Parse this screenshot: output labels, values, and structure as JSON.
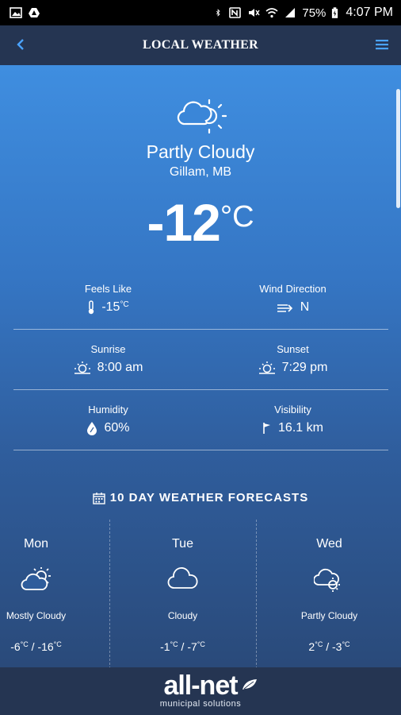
{
  "status_bar": {
    "battery": "75%",
    "time": "4:07 PM"
  },
  "app_bar": {
    "title": "LOCAL WEATHER"
  },
  "current": {
    "condition": "Partly Cloudy",
    "location": "Gillam, MB",
    "temperature": "-12",
    "unit": "°C"
  },
  "metrics": {
    "feels_like": {
      "label": "Feels Like",
      "value": "-15",
      "unit": "°C"
    },
    "wind_direction": {
      "label": "Wind Direction",
      "value": "N"
    },
    "sunrise": {
      "label": "Sunrise",
      "value": "8:00 am"
    },
    "sunset": {
      "label": "Sunset",
      "value": "7:29 pm"
    },
    "humidity": {
      "label": "Humidity",
      "value": "60%"
    },
    "visibility": {
      "label": "Visibility",
      "value": "16.1 km"
    }
  },
  "forecast": {
    "title": "10 DAY WEATHER FORECASTS",
    "days": [
      {
        "day": "Mon",
        "condition": "Mostly Cloudy",
        "high": "-6",
        "low": "-16",
        "unit": "°C",
        "icon": "sun-cloud-icon"
      },
      {
        "day": "Tue",
        "condition": "Cloudy",
        "high": "-1",
        "low": "-7",
        "unit": "°C",
        "icon": "cloud-icon"
      },
      {
        "day": "Wed",
        "condition": "Partly Cloudy",
        "high": "2",
        "low": "-3",
        "unit": "°C",
        "icon": "cloud-sun-icon"
      }
    ]
  },
  "footer": {
    "brand": "all-net",
    "tagline": "municipal solutions"
  },
  "colors": {
    "bar": "#253552",
    "gradient_top": "#3f8ee0",
    "gradient_bottom": "#2a4a7a",
    "accent": "#4aa3ff"
  }
}
